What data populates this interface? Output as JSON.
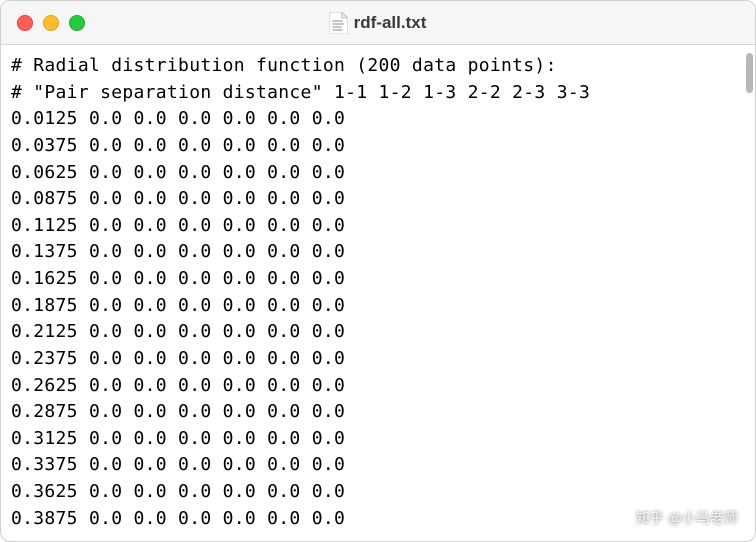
{
  "window": {
    "title": "rdf-all.txt"
  },
  "content": {
    "header1": "# Radial distribution function (200 data points):",
    "header2": "# \"Pair separation distance\" 1-1 1-2 1-3 2-2 2-3 3-3",
    "rows": [
      "0.0125 0.0 0.0 0.0 0.0 0.0 0.0",
      "0.0375 0.0 0.0 0.0 0.0 0.0 0.0",
      "0.0625 0.0 0.0 0.0 0.0 0.0 0.0",
      "0.0875 0.0 0.0 0.0 0.0 0.0 0.0",
      "0.1125 0.0 0.0 0.0 0.0 0.0 0.0",
      "0.1375 0.0 0.0 0.0 0.0 0.0 0.0",
      "0.1625 0.0 0.0 0.0 0.0 0.0 0.0",
      "0.1875 0.0 0.0 0.0 0.0 0.0 0.0",
      "0.2125 0.0 0.0 0.0 0.0 0.0 0.0",
      "0.2375 0.0 0.0 0.0 0.0 0.0 0.0",
      "0.2625 0.0 0.0 0.0 0.0 0.0 0.0",
      "0.2875 0.0 0.0 0.0 0.0 0.0 0.0",
      "0.3125 0.0 0.0 0.0 0.0 0.0 0.0",
      "0.3375 0.0 0.0 0.0 0.0 0.0 0.0",
      "0.3625 0.0 0.0 0.0 0.0 0.0 0.0",
      "0.3875 0.0 0.0 0.0 0.0 0.0 0.0"
    ]
  },
  "watermark": {
    "text": "知乎 @小马老师"
  }
}
